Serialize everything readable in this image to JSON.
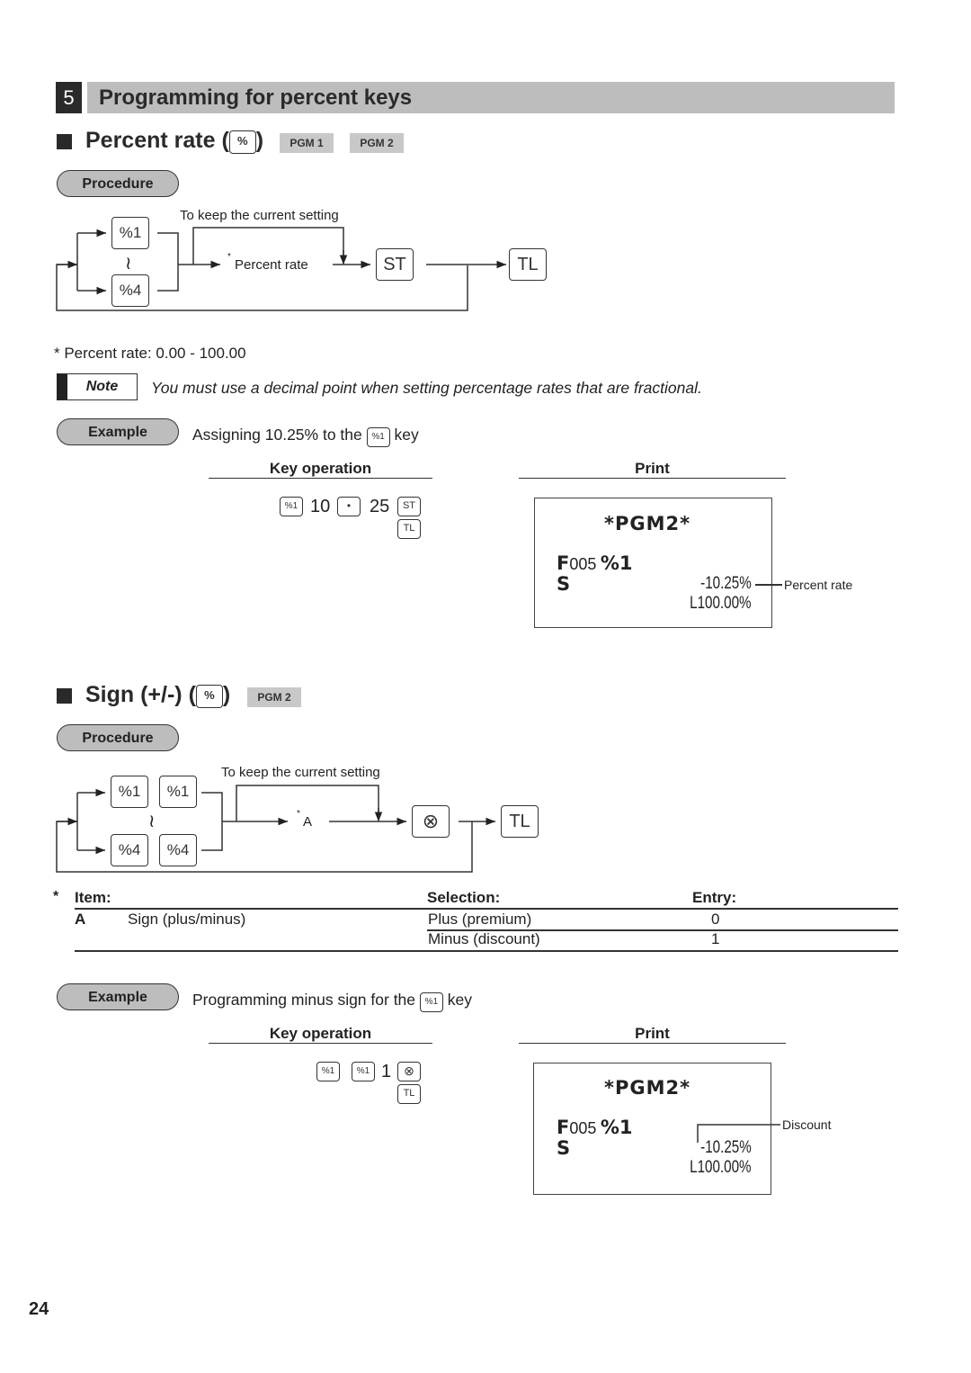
{
  "section": {
    "number": "5",
    "title": "Programming for percent keys"
  },
  "percent_rate": {
    "heading": "Percent rate (",
    "heading_close": ")",
    "heading_key": "%",
    "pgm_tags": [
      "PGM 1",
      "PGM 2"
    ],
    "procedure_label": "Procedure",
    "diagram": {
      "keep_label": "To keep the current setting",
      "key_top": "%1",
      "key_bottom": "%4",
      "range_symbol": "≀",
      "input_label": "Percent rate",
      "asterisk": "*",
      "key_st": "ST",
      "key_tl": "TL"
    },
    "footnote": "* Percent rate: 0.00 - 100.00",
    "note_label": "Note",
    "note_text": "You must use a decimal point when setting percentage rates that are fractional.",
    "example_label": "Example",
    "example_text_pre": "Assigning 10.25% to the",
    "example_key": "%1",
    "example_text_post": "key",
    "key_operation_header": "Key operation",
    "print_header": "Print",
    "key_sequence": {
      "k1": "%1",
      "v1": "10",
      "k2": "•",
      "v2": "25",
      "k3": "ST",
      "k4": "TL"
    },
    "receipt": {
      "title": "*PGM2*",
      "line1_prefix": "F",
      "line1_code": "005",
      "line1_key": "%1",
      "line2_prefix": "S",
      "rate": "-10.25%",
      "limit": "L100.00%"
    },
    "callout": "Percent rate"
  },
  "sign": {
    "heading": "Sign (+/-) (",
    "heading_close": ")",
    "heading_key": "%",
    "pgm_tags": [
      "PGM 2"
    ],
    "procedure_label": "Procedure",
    "diagram": {
      "keep_label": "To keep the current setting",
      "key_top": "%1",
      "key_bottom": "%4",
      "range_symbol": "≀",
      "input_label": "A",
      "asterisk": "*",
      "key_x": "⊗",
      "key_tl": "TL"
    },
    "table": {
      "asterisk": "*",
      "headers": {
        "item": "Item:",
        "selection": "Selection:",
        "entry": "Entry:"
      },
      "rows": [
        {
          "code": "A",
          "item": "Sign (plus/minus)",
          "selection": "Plus (premium)",
          "entry": "0"
        },
        {
          "code": "",
          "item": "",
          "selection": "Minus (discount)",
          "entry": "1"
        }
      ]
    },
    "example_label": "Example",
    "example_text_pre": "Programming minus sign for the",
    "example_key": "%1",
    "example_text_post": "key",
    "key_operation_header": "Key operation",
    "print_header": "Print",
    "key_sequence": {
      "k1": "%1",
      "k2": "%1",
      "v1": "1",
      "k3": "⊗",
      "k4": "TL"
    },
    "receipt": {
      "title": "*PGM2*",
      "line1_prefix": "F",
      "line1_code": "005",
      "line1_key": "%1",
      "line2_prefix": "S",
      "rate": "-10.25%",
      "limit": "L100.00%"
    },
    "callout": "Discount"
  },
  "page_number": "24"
}
